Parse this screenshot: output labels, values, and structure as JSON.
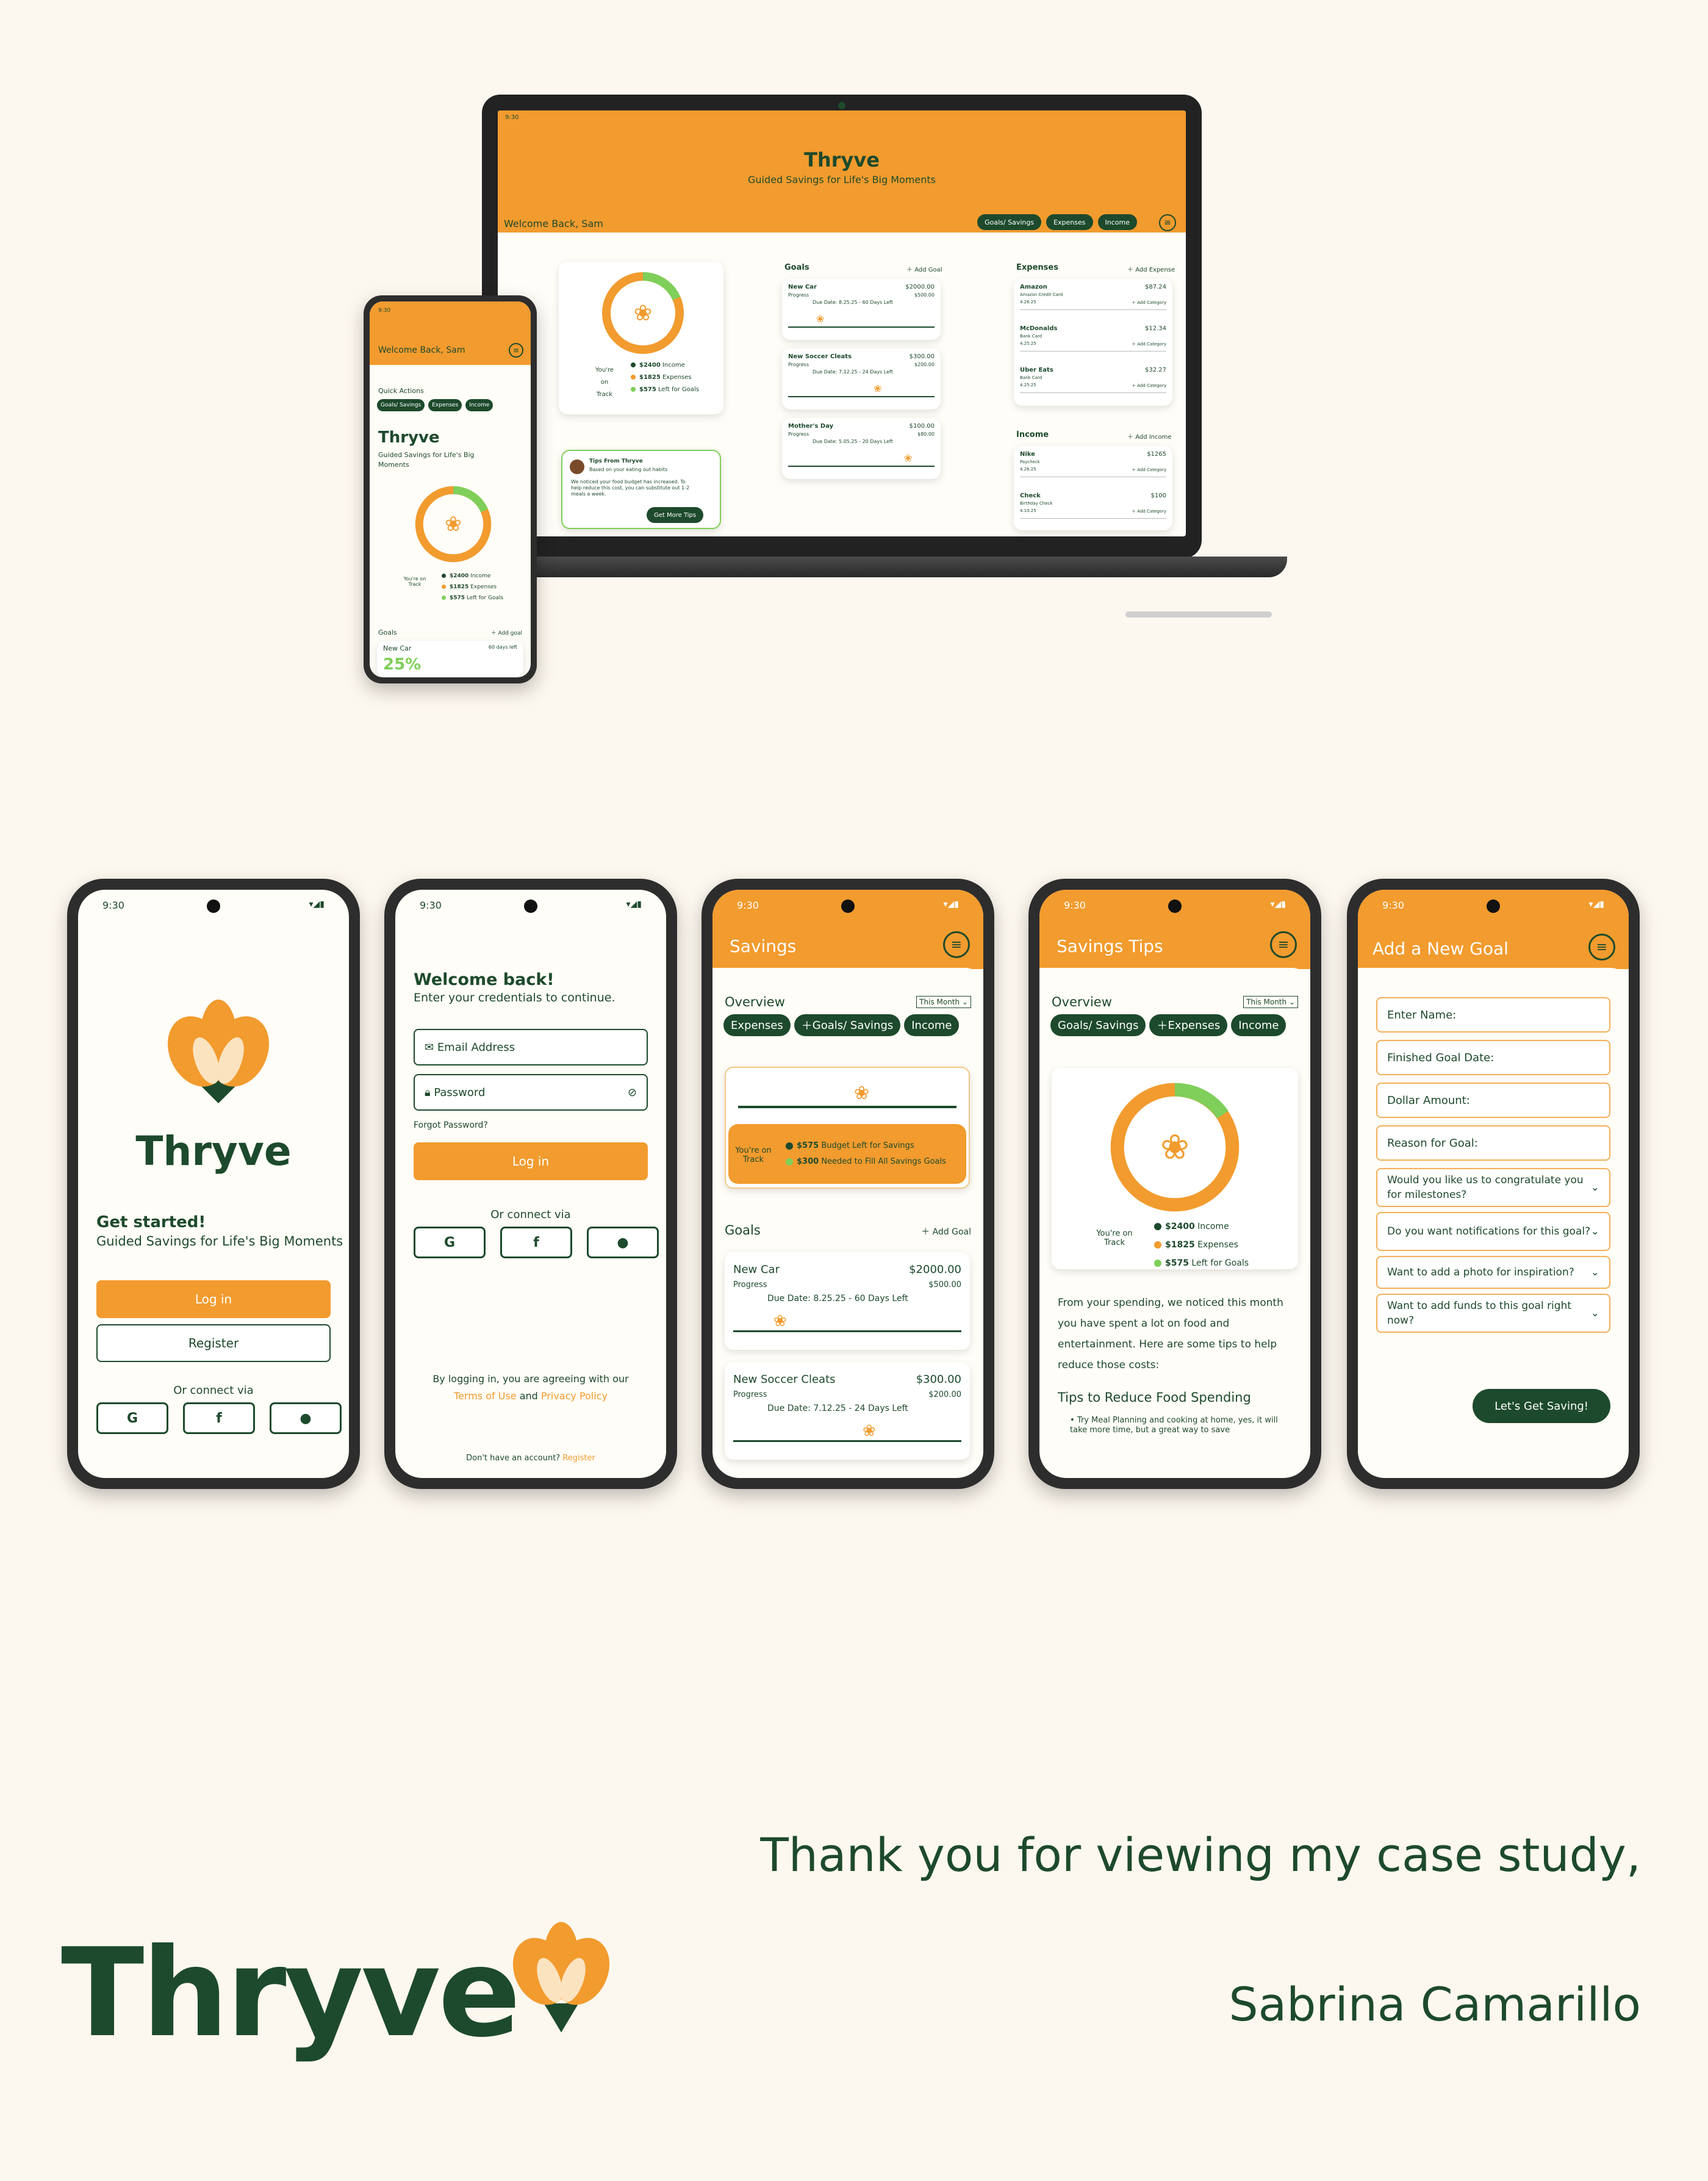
{
  "brand": {
    "name": "Thryve",
    "tagline": "Guided Savings for Life's Big Moments",
    "colors": {
      "orange": "#f29b2e",
      "green": "#1d4a2c",
      "light_green": "#7fcf5a",
      "cream": "#fdf8ef"
    }
  },
  "status_time": "9:30",
  "laptop": {
    "welcome": "Welcome Back, Sam",
    "nav": [
      "Goals/ Savings",
      "Expenses",
      "Income"
    ],
    "summary": {
      "track": "You're on Track",
      "income": "$2400",
      "income_label": "Income",
      "expenses": "$1825",
      "expenses_label": "Expenses",
      "left": "$575",
      "left_label": "Left for Goals"
    },
    "tips": {
      "title": "Tips From Thryve",
      "subtitle": "Based on your eating out habits",
      "body": "We noticed your food budget has increased. To help reduce this cost, you can substitute out 1-2 meals a week.",
      "button": "Get More Tips"
    },
    "goals": {
      "title": "Goals",
      "add": "Add Goal",
      "items": [
        {
          "name": "New Car",
          "amount": "$2000.00",
          "progress_label": "Progress",
          "progress": "$500.00",
          "due": "Due Date: 8.25.25 - 60 Days Left"
        },
        {
          "name": "New Soccer Cleats",
          "amount": "$300.00",
          "progress_label": "Progress",
          "progress": "$200.00",
          "due": "Due Date: 7.12.25 - 24 Days Left"
        },
        {
          "name": "Mother's Day",
          "amount": "$100.00",
          "progress_label": "Progress",
          "progress": "$80.00",
          "due": "Due Date: 5.05.25 - 20 Days Left"
        }
      ]
    },
    "expenses": {
      "title": "Expenses",
      "add": "Add Expense",
      "items": [
        {
          "name": "Amazon",
          "sub": "Amazon Credit Card",
          "date": "4.26.25",
          "amount": "$87.24",
          "cat": "Add Category"
        },
        {
          "name": "McDonalds",
          "sub": "Bank Card",
          "date": "4.25.25",
          "amount": "$12.34",
          "cat": "Add Category"
        },
        {
          "name": "Uber Eats",
          "sub": "Bank Card",
          "date": "4.25.25",
          "amount": "$32.27",
          "cat": "Add Category"
        }
      ]
    },
    "income": {
      "title": "Income",
      "add": "Add Income",
      "items": [
        {
          "name": "Nike",
          "sub": "Paycheck",
          "date": "4.26.25",
          "amount": "$1265",
          "cat": "Add Category"
        },
        {
          "name": "Check",
          "sub": "Birthday Check",
          "date": "4.10.25",
          "amount": "$100",
          "cat": "Add Category"
        }
      ]
    }
  },
  "small_phone": {
    "welcome": "Welcome Back, Sam",
    "quick": "Quick Actions",
    "nav": [
      "Goals/ Savings",
      "Expenses",
      "Income"
    ],
    "goals": "Goals",
    "add": "Add goal",
    "car": "New Car",
    "days": "60 days left",
    "pct": "25%"
  },
  "screen1": {
    "get_started": "Get started!",
    "login": "Log in",
    "register": "Register",
    "connect": "Or connect via"
  },
  "screen2": {
    "welcome": "Welcome back!",
    "enter": "Enter your credentials to continue.",
    "email": "Email Address",
    "password": "Password",
    "forgot": "Forgot Password?",
    "login": "Log in",
    "connect": "Or connect via",
    "agree": "By logging in, you are agreeing with our",
    "terms": "Terms of Use",
    "and": "and",
    "privacy": "Privacy Policy",
    "no_account": "Don't have an account?",
    "register": "Register"
  },
  "screen3": {
    "title": "Savings",
    "overview": "Overview",
    "month": "This Month",
    "tabs": [
      "Expenses",
      "Goals/ Savings",
      "Income"
    ],
    "track": "You're on Track",
    "budget": "$575",
    "budget_label": "Budget Left for Savings",
    "needed": "$300",
    "needed_label": "Needed to Fill All Savings Goals",
    "goals": "Goals",
    "add": "Add Goal",
    "items": [
      {
        "name": "New Car",
        "amount": "$2000.00",
        "progress_label": "Progress",
        "progress": "$500.00",
        "due": "Due Date: 8.25.25 - 60 Days Left"
      },
      {
        "name": "New Soccer Cleats",
        "amount": "$300.00",
        "progress_label": "Progress",
        "progress": "$200.00",
        "due": "Due Date: 7.12.25 - 24 Days Left"
      }
    ]
  },
  "screen4": {
    "title": "Savings Tips",
    "overview": "Overview",
    "month": "This Month",
    "tabs": [
      "Goals/ Savings",
      "Expenses",
      "Income"
    ],
    "track": "You're on Track",
    "income": "$2400",
    "income_label": "Income",
    "expenses": "$1825",
    "expenses_label": "Expenses",
    "left": "$575",
    "left_label": "Left for Goals",
    "body": "From your spending, we noticed this month you have spent a lot on food and entertainment. Here are some tips to help reduce those costs:",
    "tips_title": "Tips to Reduce Food Spending",
    "tip1": "Try Meal Planning and cooking at home, yes, it will take more time, but a great way to save"
  },
  "screen5": {
    "title": "Add a New Goal",
    "fields": [
      "Enter Name:",
      "Finished Goal Date:",
      "Dollar Amount:",
      "Reason for Goal:"
    ],
    "selects": [
      "Would you like us to congratulate you for milestones?",
      "Do you want notifications for this goal?",
      "Want to add a photo for inspiration?",
      "Want to add funds to this goal right now?"
    ],
    "button": "Let's Get Saving!"
  },
  "footer": {
    "thanks": "Thank you for viewing my case study,",
    "author": "Sabrina Camarillo"
  }
}
